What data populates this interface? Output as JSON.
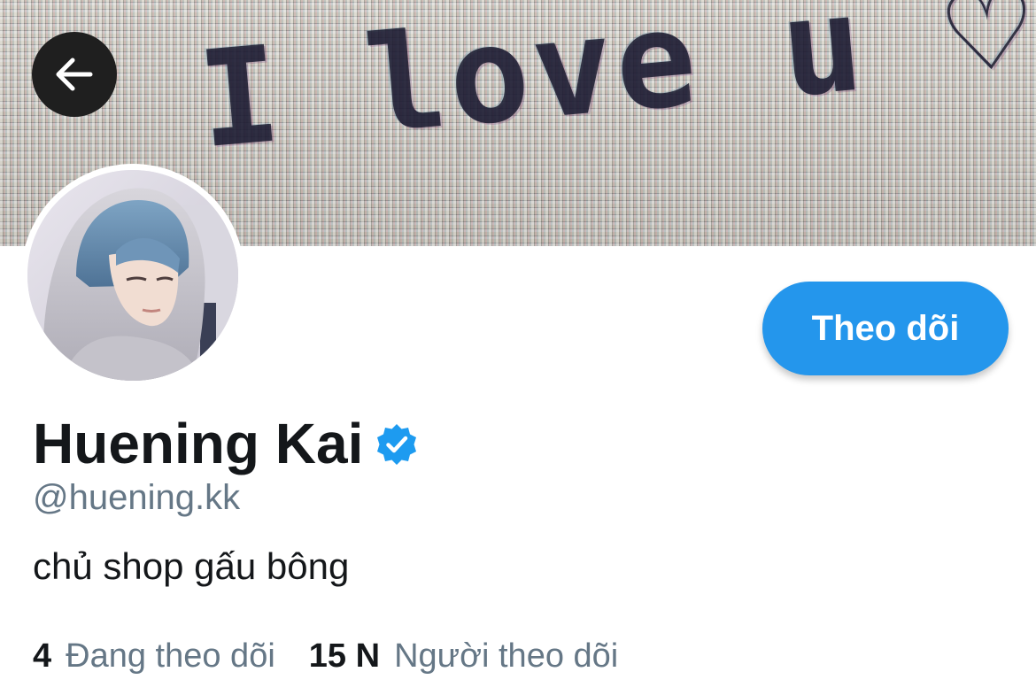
{
  "banner": {
    "text": "I love u ♡",
    "icon": "heart-icon"
  },
  "header": {
    "back_icon": "arrow-left-icon"
  },
  "profile": {
    "display_name": "Huening Kai",
    "verified_icon": "verified-badge-icon",
    "handle": "@huening.kk",
    "bio": "chủ shop gấu bông",
    "follow_label": "Theo dõi",
    "stats": {
      "following_count": "4",
      "following_label": "Đang theo dõi",
      "followers_count": "15 N",
      "followers_label": "Người theo dõi"
    }
  },
  "colors": {
    "accent": "#2496ec",
    "text_primary": "#14171a",
    "text_secondary": "#657786",
    "back_button_bg": "#1f1f1f"
  }
}
